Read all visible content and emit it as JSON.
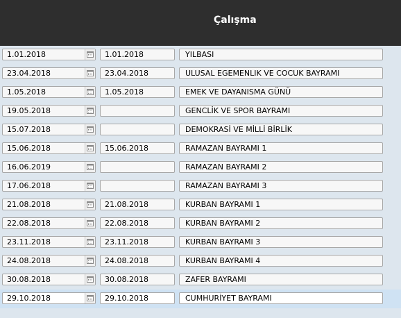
{
  "header": {
    "title": "Çalışma"
  },
  "icons": {
    "date_picker": "calendar-icon"
  },
  "holidays": [
    {
      "start": "1.01.2018",
      "end": "1.01.2018",
      "name": "YILBASI"
    },
    {
      "start": "23.04.2018",
      "end": "23.04.2018",
      "name": "ULUSAL EGEMENLIK VE COCUK BAYRAMI"
    },
    {
      "start": "1.05.2018",
      "end": "1.05.2018",
      "name": "EMEK VE DAYANISMA GÜNÜ"
    },
    {
      "start": "19.05.2018",
      "end": "",
      "name": "GENCLİK VE SPOR BAYRAMI"
    },
    {
      "start": "15.07.2018",
      "end": "",
      "name": "DEMOKRASİ VE MİLLİ BİRLİK"
    },
    {
      "start": "15.06.2018",
      "end": "15.06.2018",
      "name": "RAMAZAN BAYRAMI 1"
    },
    {
      "start": "16.06.2019",
      "end": "",
      "name": "RAMAZAN BAYRAMI 2"
    },
    {
      "start": "17.06.2018",
      "end": "",
      "name": "RAMAZAN BAYRAMI 3"
    },
    {
      "start": "21.08.2018",
      "end": "21.08.2018",
      "name": "KURBAN BAYRAMI 1"
    },
    {
      "start": "22.08.2018",
      "end": "22.08.2018",
      "name": "KURBAN BAYRAMI 2"
    },
    {
      "start": "23.11.2018",
      "end": "23.11.2018",
      "name": "KURBAN BAYRAMI 3"
    },
    {
      "start": "24.08.2018",
      "end": "24.08.2018",
      "name": "KURBAN BAYRAMI 4"
    },
    {
      "start": "30.08.2018",
      "end": "30.08.2018",
      "name": "ZAFER BAYRAMI"
    },
    {
      "start": "29.10.2018",
      "end": "29.10.2018",
      "name": "CUMHURİYET BAYRAMI",
      "selected": true
    }
  ]
}
